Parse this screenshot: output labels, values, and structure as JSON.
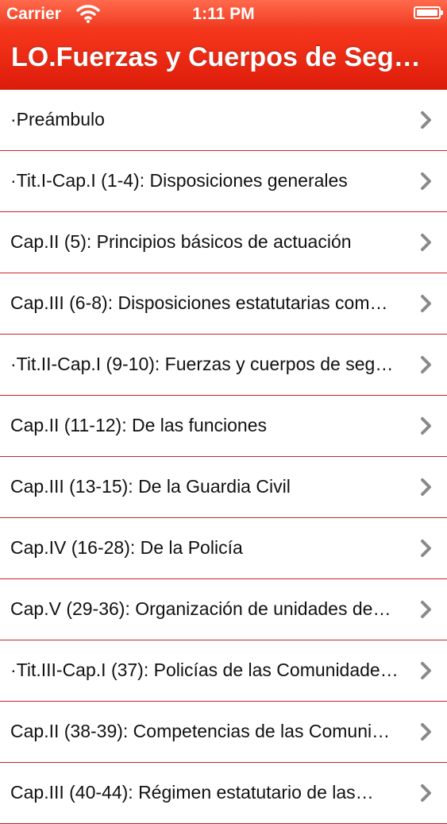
{
  "status_bar": {
    "carrier": "Carrier",
    "time": "1:11 PM",
    "wifi_icon": "wifi-icon",
    "battery_icon": "battery-icon"
  },
  "nav": {
    "title": "LO.Fuerzas y Cuerpos de Seg…"
  },
  "colors": {
    "accent": "#e0200e",
    "separator": "#c8232c",
    "chevron": "#8a8a8a"
  },
  "list": {
    "items": [
      {
        "label": "·Preámbulo"
      },
      {
        "label": "·Tit.I-Cap.I (1-4): Disposiciones generales"
      },
      {
        "label": "Cap.II (5): Principios básicos de actuación"
      },
      {
        "label": "Cap.III (6-8): Disposiciones estatutarias com…"
      },
      {
        "label": "·Tit.II-Cap.I (9-10): Fuerzas y cuerpos de seg…"
      },
      {
        "label": "Cap.II (11-12): De las funciones"
      },
      {
        "label": "Cap.III (13-15): De la Guardia Civil"
      },
      {
        "label": "Cap.IV (16-28): De la Policía"
      },
      {
        "label": "Cap.V (29-36): Organización de unidades de…"
      },
      {
        "label": "·Tit.III-Cap.I (37): Policías de las Comunidade…"
      },
      {
        "label": "Cap.II (38-39): Competencias de las Comuni…"
      },
      {
        "label": "Cap.III (40-44): Régimen estatutario de las…"
      }
    ],
    "chevron_icon": "chevron-right-icon"
  }
}
